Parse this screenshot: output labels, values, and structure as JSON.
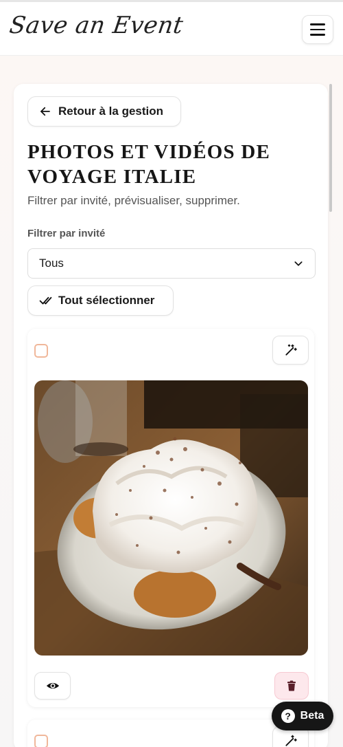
{
  "header": {
    "logo_text": "Save an Event",
    "menu_icon": "hamburger-menu-icon"
  },
  "nav": {
    "back_label": "Retour à la gestion",
    "back_icon": "arrow-left-icon"
  },
  "page": {
    "title": "PHOTOS ET VIDÉOS DE VOYAGE ITALIE",
    "subtitle": "Filtrer par invité, prévisualiser, supprimer."
  },
  "filter": {
    "label": "Filtrer par invité",
    "selected": "Tous",
    "icon": "chevron-down-icon"
  },
  "actions": {
    "select_all_label": "Tout sélectionner",
    "select_all_icon": "double-check-icon"
  },
  "media": [
    {
      "type": "photo",
      "subject": "cream-puff dessert with whipped cream on a plate",
      "checked": false,
      "enhance_icon": "magic-wand-icon",
      "view_icon": "eye-icon",
      "delete_icon": "trash-icon"
    }
  ],
  "beta": {
    "label": "Beta",
    "icon": "question-circle-icon"
  },
  "colors": {
    "checkbox_border": "#f0b79a",
    "delete_bg": "#fde8ec",
    "delete_icon": "#5a1f2a",
    "beta_bg": "#161616"
  }
}
